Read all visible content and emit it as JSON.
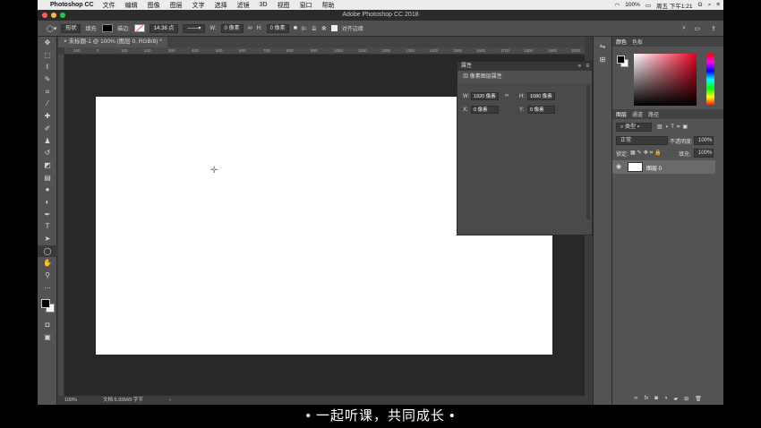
{
  "menubar": {
    "app": "Photoshop CC",
    "items": [
      "文件",
      "编辑",
      "图像",
      "图层",
      "文字",
      "选择",
      "滤镜",
      "3D",
      "视图",
      "窗口",
      "帮助"
    ],
    "battery": "100%",
    "clock": "周五 下午1:21",
    "g_label": "G"
  },
  "window": {
    "title": "Adobe Photoshop CC 2018"
  },
  "options": {
    "mode": "形状",
    "fill_label": "填充:",
    "stroke_label": "描边:",
    "stroke_size": "14.38 点",
    "w_label": "W:",
    "w_value": "0 像素",
    "h_label": "H:",
    "h_value": "0 像素",
    "align_edges": "对齐边缘"
  },
  "document": {
    "tab": "未标题-1 @ 100% (图层 0, RGB/8) *",
    "zoom": "100%",
    "status": "文档:5.93M/0 字节"
  },
  "ruler_ticks": [
    "100",
    "0",
    "100",
    "200",
    "300",
    "400",
    "500",
    "600",
    "700",
    "800",
    "900",
    "1000",
    "1100",
    "1200",
    "1300",
    "1400",
    "1500",
    "1600",
    "1700",
    "1800",
    "1900",
    "2000"
  ],
  "properties": {
    "title": "属性",
    "section": "像素图层属性",
    "w_label": "W:",
    "w_value": "1920 像素",
    "h_label": "H:",
    "h_value": "1080 像素",
    "x_label": "X:",
    "x_value": "0 像素",
    "y_label": "Y:",
    "y_value": "0 像素"
  },
  "color_panel": {
    "tabs": [
      "颜色",
      "色板"
    ]
  },
  "layers_panel": {
    "tabs": [
      "图层",
      "通道",
      "路径"
    ],
    "kind": "类型",
    "blend": "正常",
    "opacity_label": "不透明度:",
    "opacity": "100%",
    "lock_label": "锁定:",
    "fill_label": "填充:",
    "fill": "100%",
    "layer_name": "图层 0"
  },
  "subtitle": "• 一起听课，共同成长 •"
}
